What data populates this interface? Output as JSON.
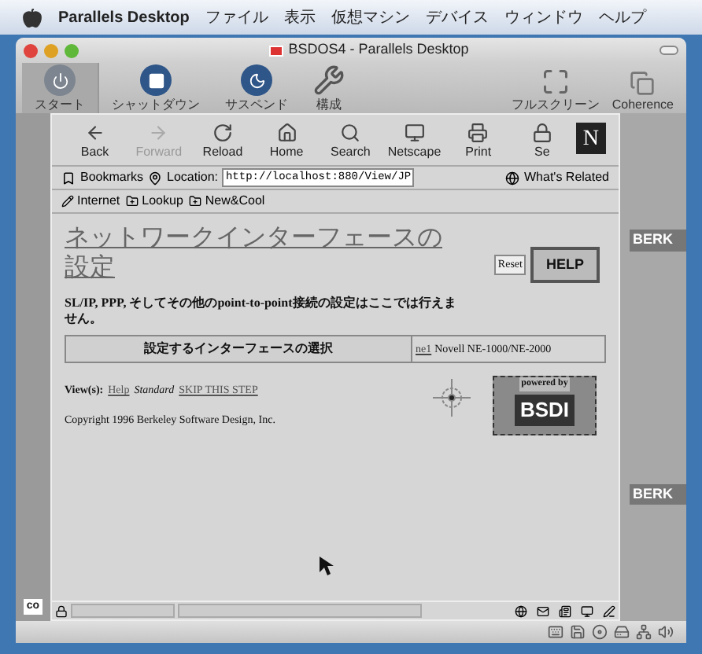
{
  "menubar": {
    "app": "Parallels Desktop",
    "menus": [
      "ファイル",
      "表示",
      "仮想マシン",
      "デバイス",
      "ウィンドウ",
      "ヘルプ"
    ]
  },
  "window": {
    "title": "BSDOS4 - Parallels Desktop"
  },
  "toolbar": [
    {
      "label": "スタート",
      "kind": "power",
      "selected": true
    },
    {
      "label": "シャットダウン",
      "kind": "stop",
      "selected": false
    },
    {
      "label": "サスペンド",
      "kind": "moon",
      "selected": false
    },
    {
      "label": "構成",
      "kind": "tools",
      "selected": false
    }
  ],
  "toolbar_right": [
    {
      "label": "フルスクリーン",
      "kind": "fullscreen"
    },
    {
      "label": "Coherence",
      "kind": "coherence"
    }
  ],
  "guest_side": {
    "left_label": "co",
    "right_labels": [
      "BERK",
      "BERK"
    ]
  },
  "browser": {
    "nav": [
      {
        "label": "Back",
        "kind": "back",
        "disabled": false
      },
      {
        "label": "Forward",
        "kind": "forward",
        "disabled": true
      },
      {
        "label": "Reload",
        "kind": "reload",
        "disabled": false
      },
      {
        "label": "Home",
        "kind": "home",
        "disabled": false
      },
      {
        "label": "Search",
        "kind": "search",
        "disabled": false
      },
      {
        "label": "Netscape",
        "kind": "netscape",
        "disabled": false
      },
      {
        "label": "Print",
        "kind": "print",
        "disabled": false
      },
      {
        "label": "Se",
        "kind": "security",
        "disabled": false
      }
    ],
    "logo": "N",
    "bookmarks": "Bookmarks",
    "location_label": "Location:",
    "url": "http://localhost:880/View/JP",
    "related": "What's Related",
    "personal": [
      "Internet",
      "Lookup",
      "New&Cool"
    ],
    "page": {
      "title": "ネットワークインターフェースの設定",
      "reset": "Reset",
      "help": "HELP",
      "note": "SL/IP, PPP, そしてその他のpoint-to-point接続の設定はここでは行えません。",
      "select_label": "設定するインターフェースの選択",
      "interface_link": "ne1",
      "interface_text": "Novell NE-1000/NE-2000",
      "views_label": "View(s):",
      "views": [
        {
          "label": "Help",
          "kind": "link"
        },
        {
          "label": "Standard",
          "kind": "current"
        },
        {
          "label": "SKIP THIS STEP",
          "kind": "link"
        }
      ],
      "badge_top": "powered by",
      "badge": "BSDI",
      "copyright": "Copyright 1996 Berkeley Software Design, Inc."
    }
  }
}
